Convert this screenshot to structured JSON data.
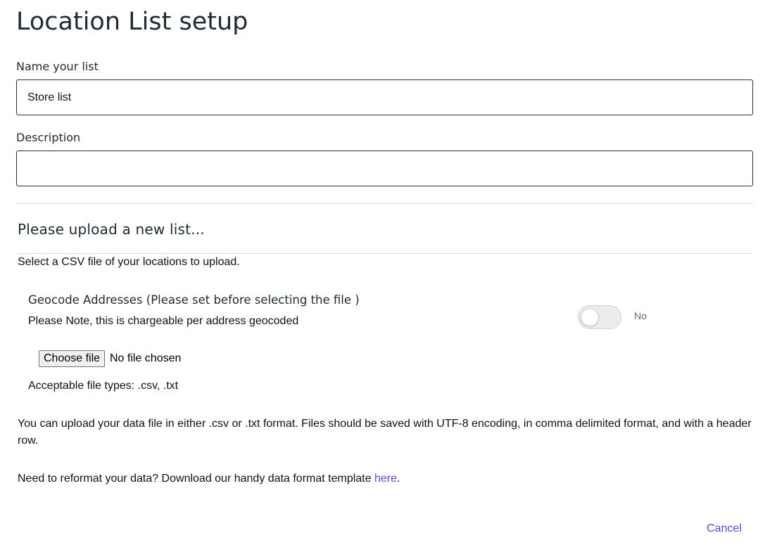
{
  "header": {
    "title": "Location List setup"
  },
  "form": {
    "name": {
      "label": "Name your list",
      "value": "Store list"
    },
    "description": {
      "label": "Description",
      "value": ""
    }
  },
  "upload": {
    "heading": "Please upload a new list...",
    "instructions": "Select a CSV file of your locations to upload.",
    "geocode": {
      "label": "Geocode Addresses (Please set before selecting the file )",
      "note": "Please Note, this is chargeable per address geocoded",
      "toggle_state": "No",
      "enabled": false
    },
    "file_input": {
      "button_label": "Choose file",
      "status": "No file chosen"
    },
    "acceptable_types": "Acceptable file types: .csv, .txt",
    "format_help": "You can upload your data file in either .csv or .txt format. Files should be saved with UTF-8 encoding, in comma delimited format, and with a header row.",
    "template_help": {
      "prefix": "Need to reformat your data? Download our handy data format template ",
      "link_text": "here",
      "suffix": "."
    }
  },
  "actions": {
    "cancel_label": "Cancel"
  },
  "colors": {
    "link": "#4a4ee0",
    "text": "#1f2a33"
  }
}
